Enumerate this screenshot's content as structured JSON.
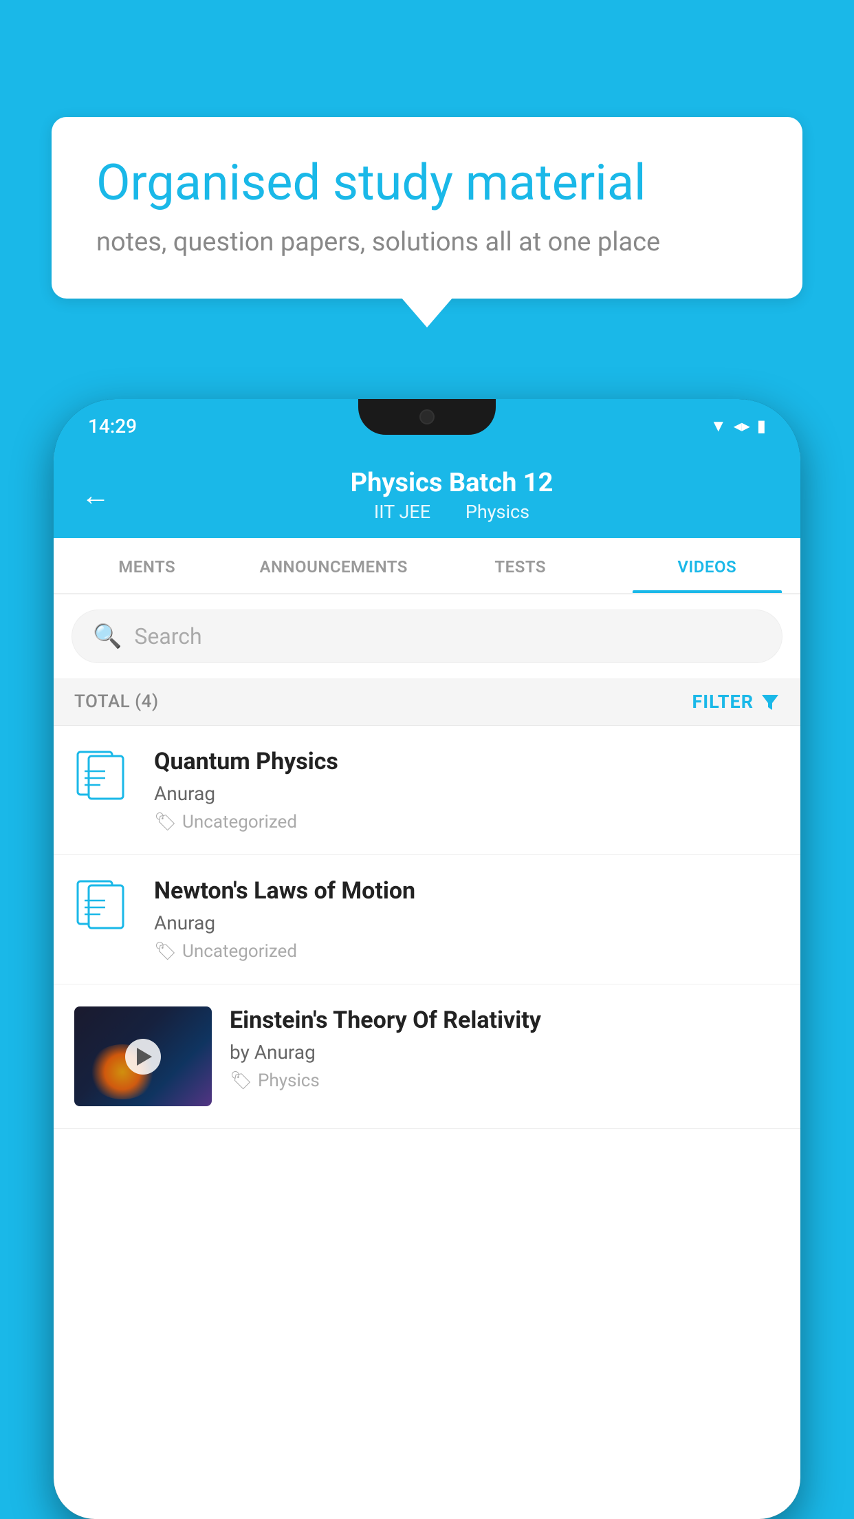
{
  "background": {
    "color": "#1ab8e8"
  },
  "speech_bubble": {
    "title": "Organised study material",
    "subtitle": "notes, question papers, solutions all at one place"
  },
  "phone": {
    "status_bar": {
      "time": "14:29",
      "icons": [
        "wifi",
        "signal",
        "battery"
      ]
    },
    "header": {
      "title": "Physics Batch 12",
      "subtitle_parts": [
        "IIT JEE",
        "Physics"
      ],
      "back_label": "←"
    },
    "tabs": [
      {
        "label": "MENTS",
        "active": false
      },
      {
        "label": "ANNOUNCEMENTS",
        "active": false
      },
      {
        "label": "TESTS",
        "active": false
      },
      {
        "label": "VIDEOS",
        "active": true
      }
    ],
    "search": {
      "placeholder": "Search"
    },
    "filter_bar": {
      "total_label": "TOTAL (4)",
      "filter_label": "FILTER"
    },
    "videos": [
      {
        "id": 1,
        "title": "Quantum Physics",
        "author": "Anurag",
        "tag": "Uncategorized",
        "has_thumbnail": false
      },
      {
        "id": 2,
        "title": "Newton's Laws of Motion",
        "author": "Anurag",
        "tag": "Uncategorized",
        "has_thumbnail": false
      },
      {
        "id": 3,
        "title": "Einstein's Theory Of Relativity",
        "author": "by Anurag",
        "tag": "Physics",
        "has_thumbnail": true
      }
    ]
  }
}
